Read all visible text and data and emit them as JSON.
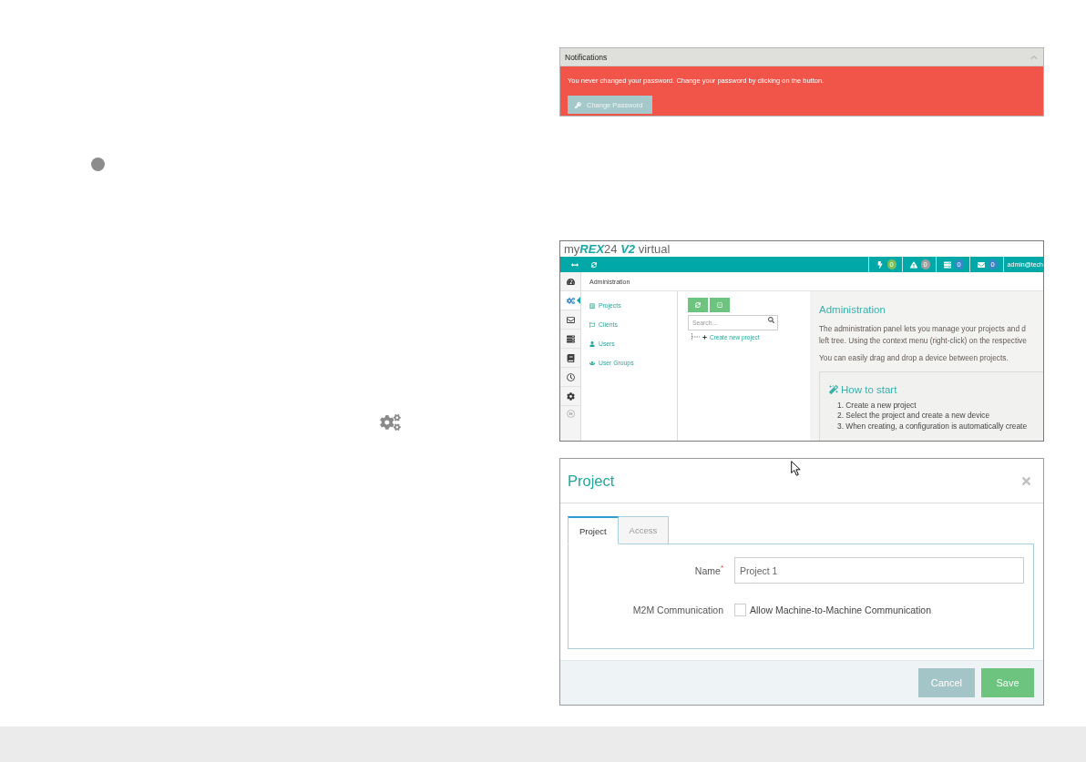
{
  "notifications": {
    "title": "Notifications",
    "expanded": true,
    "message": "You never changed your password. Change your password by clicking on the button.",
    "button": "Change Password"
  },
  "app_screenshot": {
    "logo": "my**REX**24 **V2** virtual",
    "topbar": {
      "counters": [
        {
          "kind": "bolt",
          "count": "0",
          "color": "#7cbd5c"
        },
        {
          "kind": "warning",
          "count": "0",
          "color": "#a0a0a0"
        },
        {
          "kind": "list",
          "count": "0",
          "color": "#3a87c8"
        },
        {
          "kind": "mail",
          "count": "0",
          "color": "#3a87c8"
        }
      ],
      "user": "admin@tech"
    },
    "sidebar": [
      {
        "kind": "dashboard",
        "selected": false
      },
      {
        "kind": "admin",
        "selected": true
      },
      {
        "kind": "mail",
        "selected": false
      },
      {
        "kind": "list",
        "selected": false
      },
      {
        "kind": "book",
        "selected": false
      },
      {
        "kind": "clock",
        "selected": false
      },
      {
        "kind": "settings",
        "selected": false
      }
    ],
    "breadcrumb": "Administration",
    "nav": [
      {
        "kind": "projects",
        "label": "Projects"
      },
      {
        "kind": "clients",
        "label": "Clients"
      },
      {
        "kind": "users",
        "label": "Users"
      },
      {
        "kind": "groups",
        "label": "User Groups"
      }
    ],
    "tree": {
      "tools": [
        {
          "kind": "refresh"
        },
        {
          "kind": "collapse"
        }
      ],
      "search_placeholder": "Search...",
      "items": [
        {
          "kind": "create",
          "label": "Create new project"
        }
      ]
    },
    "info": {
      "heading": "Administration",
      "lines": [
        "The administration panel lets you manage your projects and d",
        "left tree. Using the context menu (right-click) on the respective"
      ],
      "note": "You can easily drag and drop a device between projects.",
      "how_to": {
        "title": "How to start",
        "steps": [
          "1. Create a new project",
          "2. Select the project and create a new device",
          "3. When creating, a configuration is automatically create"
        ]
      }
    }
  },
  "dialog": {
    "title": "Project",
    "tabs": [
      {
        "label": "Project",
        "selected": true
      },
      {
        "label": "Access",
        "selected": false
      }
    ],
    "fields": [
      {
        "kind": "text",
        "label": "Name",
        "required_mark": "*",
        "value": "Project 1"
      },
      {
        "kind": "checkbox",
        "label": "M2M Communication",
        "checked": false,
        "option": "Allow Machine-to-Machine Communication"
      }
    ],
    "buttons": [
      {
        "kind": "cancel",
        "label": "Cancel"
      },
      {
        "kind": "save",
        "label": "Save"
      }
    ]
  }
}
